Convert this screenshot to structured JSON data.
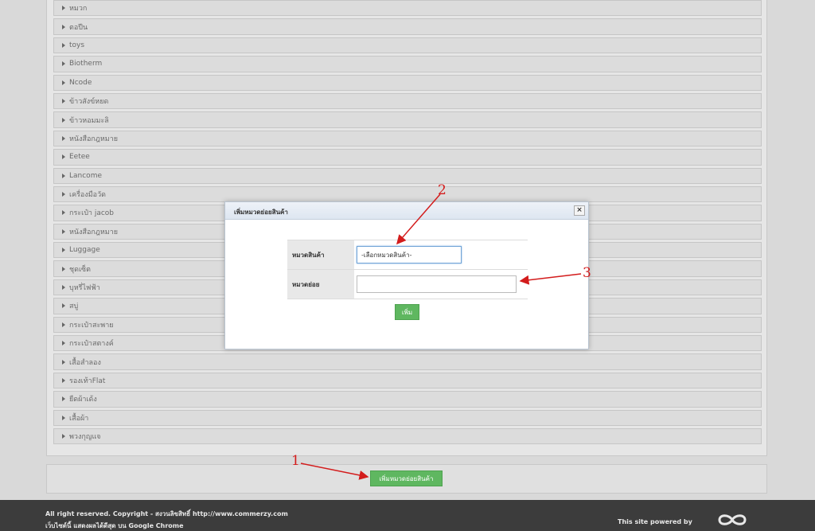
{
  "categories": [
    "หมวก",
    "ตอปีน",
    "toys",
    "Biotherm",
    "Ncode",
    "ข้าวสังข์หยด",
    "ข้าวหอมมะลิ",
    "หนังสือกฎหมาย",
    "Eetee",
    "Lancome",
    "เครื่องมือวัด",
    "กระเป๋า jacob",
    "หนังสือกฎหมาย",
    "Luggage",
    "ชุดเซ็ต",
    "บุหรี่ไฟฟ้า",
    "สบู่",
    "กระเป๋าสะพาย",
    "กระเป๋าสตางค์",
    "เสื้อสำลอง",
    "รองเท้าFlat",
    "ยืดผ้าเด้ง",
    "เสื้อผ้า",
    "พวงกุญแจ"
  ],
  "add_subcategory_label": "เพิ่มหมวดย่อยสินค้า",
  "modal": {
    "title": "เพิ่มหมวดย่อยสินค้า",
    "close_label": "×",
    "category_label": "หมวดสินค้า",
    "category_selected": "-เลือกหมวดสินค้า-",
    "subcategory_label": "หมวดย่อย",
    "subcategory_value": "",
    "add_label": "เพิ่ม"
  },
  "footer": {
    "copyright": "All right reserved. Copyright - สงวนลิขสิทธิ์ http://www.commerzy.com",
    "browser_note": "เว็บไซต์นี้ แสดงผลได้ดีสุด บน Google Chrome",
    "powered_by": "This site powered by"
  },
  "annotations": [
    "1",
    "2",
    "3"
  ],
  "colors": {
    "annotation": "#d31c1c",
    "button": "#5fb760"
  }
}
